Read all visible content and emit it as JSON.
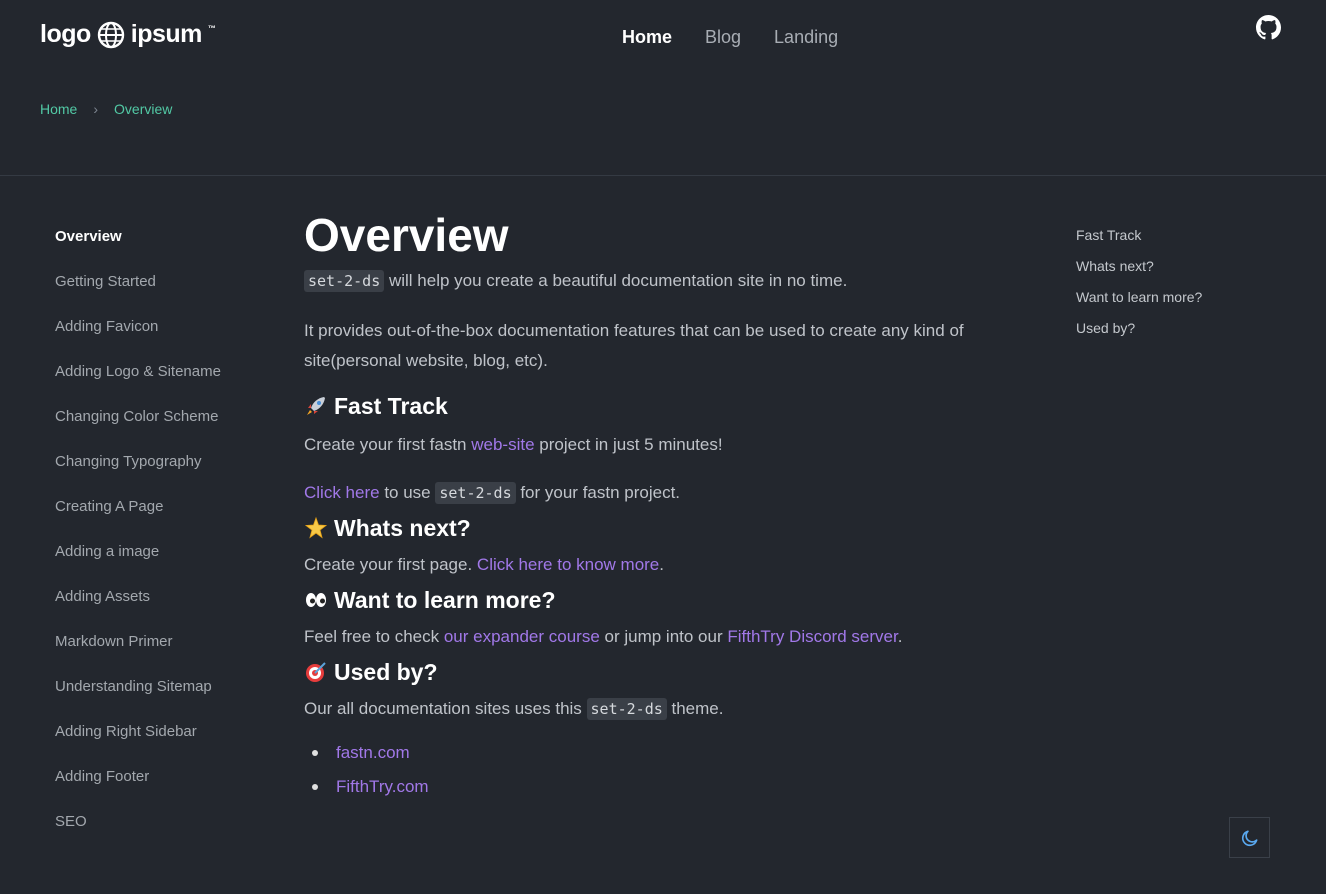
{
  "header": {
    "logo": {
      "left": "logo",
      "right": "ipsum",
      "tm": "™"
    },
    "nav": [
      {
        "label": "Home",
        "active": true
      },
      {
        "label": "Blog",
        "active": false
      },
      {
        "label": "Landing",
        "active": false
      }
    ],
    "github_icon": "github-icon"
  },
  "breadcrumb": {
    "home": "Home",
    "separator": "›",
    "current": "Overview"
  },
  "sidebar": {
    "items": [
      {
        "label": "Overview",
        "active": true
      },
      {
        "label": "Getting Started"
      },
      {
        "label": "Adding Favicon"
      },
      {
        "label": "Adding Logo & Sitename"
      },
      {
        "label": "Changing Color Scheme"
      },
      {
        "label": "Changing Typography"
      },
      {
        "label": "Creating A Page"
      },
      {
        "label": "Adding a image"
      },
      {
        "label": "Adding Assets"
      },
      {
        "label": "Markdown Primer"
      },
      {
        "label": "Understanding Sitemap"
      },
      {
        "label": "Adding Right Sidebar"
      },
      {
        "label": "Adding Footer"
      },
      {
        "label": "SEO"
      }
    ]
  },
  "main": {
    "title": "Overview",
    "intro": {
      "code": "set-2-ds",
      "text": " will help you create a beautiful documentation site in no time."
    },
    "provides": "It provides out-of-the-box documentation features that can be used to create any kind of site(personal website, blog, etc).",
    "fast_track": {
      "heading": "Fast Track",
      "line1_pre": "Create your first fastn ",
      "line1_link": "web-site",
      "line1_post": " project in just 5 minutes!",
      "line2_link": "Click here",
      "line2_mid": " to use ",
      "line2_code": "set-2-ds",
      "line2_post": " for your fastn project."
    },
    "whats_next": {
      "heading": "Whats next?",
      "pre": "Create your first page. ",
      "link": "Click here to know more",
      "post": "."
    },
    "learn_more": {
      "heading": "Want to learn more?",
      "pre": "Feel free to check ",
      "link1": "our expander course",
      "mid": " or jump into our ",
      "link2": "FifthTry Discord server",
      "post": "."
    },
    "used_by": {
      "heading": "Used by?",
      "pre": "Our all documentation sites uses this ",
      "code": "set-2-ds",
      "post": " theme.",
      "sites": [
        "fastn.com",
        "FifthTry.com"
      ]
    }
  },
  "toc": [
    "Fast Track",
    "Whats next?",
    "Want to learn more?",
    "Used by?"
  ],
  "theme_toggle_icon": "moon-icon",
  "colors": {
    "background": "#23272e",
    "link": "#a178e8",
    "breadcrumb": "#52c9a5"
  }
}
